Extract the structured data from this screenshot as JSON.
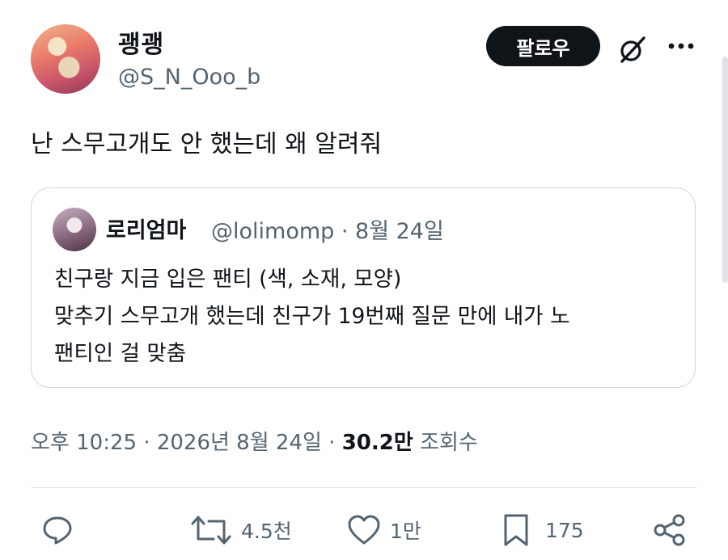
{
  "author": {
    "display_name": "괭괭",
    "handle": "@S_N_Ooo_b",
    "follow_label": "팔로우"
  },
  "tweet": {
    "text": "난 스무고개도 안 했는데 왜 알려줘"
  },
  "quote": {
    "display_name": "로리엄마",
    "meta": "@lolimomp · 8월 24일",
    "lines": [
      "친구랑 지금 입은 팬티 (색, 소재, 모양)",
      "맞추기 스무고개 했는데 친구가 19번째 질문 만에 내가 노",
      "팬티인 걸 맞춤"
    ]
  },
  "stats": {
    "time": "오후 10:25 · 2026년 8월 24일 · ",
    "views_count": "30.2만",
    "views_label": "조회수"
  },
  "actions": {
    "retweets": "4.5천",
    "likes": "1만",
    "bookmarks": "175"
  },
  "icons": {
    "grok": "grok-icon",
    "more": "more-dots-icon",
    "reply": "reply-bubble-icon",
    "retweet": "retweet-icon",
    "like": "heart-icon",
    "bookmark": "bookmark-icon",
    "share": "share-icon"
  },
  "colors": {
    "text": "#0f1419",
    "secondary": "#536471",
    "button_bg": "#0f1419",
    "border": "#cfd9de"
  }
}
